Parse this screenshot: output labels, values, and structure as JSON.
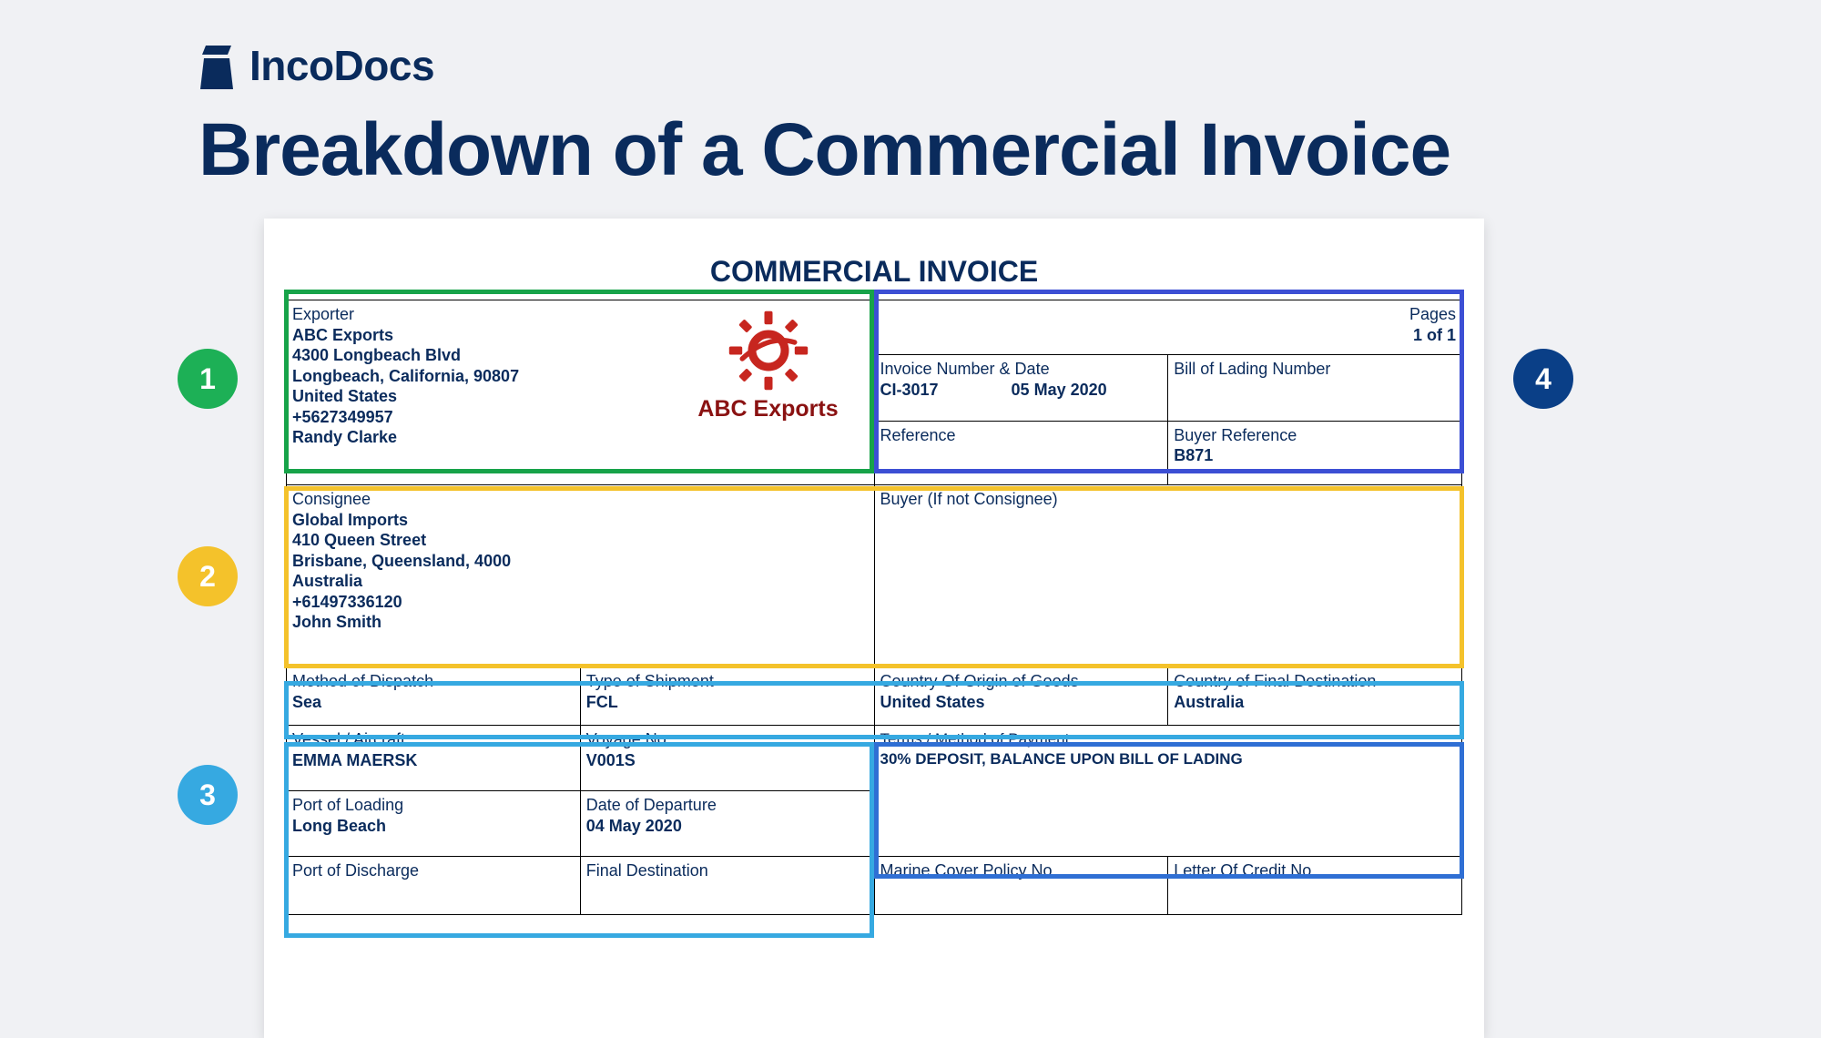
{
  "brand_name": "IncoDocs",
  "page_title": "Breakdown of a Commercial Invoice",
  "doc_title": "COMMERCIAL INVOICE",
  "badges": {
    "one": "1",
    "two": "2",
    "three": "3",
    "four": "4"
  },
  "exporter": {
    "label": "Exporter",
    "name": "ABC Exports",
    "addr1": "4300 Longbeach Blvd",
    "addr2": "Longbeach, California, 90807",
    "country": "United States",
    "phone": "+5627349957",
    "contact": "Randy Clarke",
    "logo_name": "ABC Exports"
  },
  "pages": {
    "label": "Pages",
    "value": "1 of 1"
  },
  "invoice_no": {
    "label": "Invoice Number & Date",
    "no": "CI-3017",
    "date": "05 May 2020"
  },
  "bol": {
    "label": "Bill of Lading Number",
    "value": ""
  },
  "reference": {
    "label": "Reference",
    "value": ""
  },
  "buyer_ref": {
    "label": "Buyer Reference",
    "value": "B871"
  },
  "consignee": {
    "label": "Consignee",
    "name": "Global Imports",
    "addr1": "410 Queen Street",
    "addr2": "Brisbane, Queensland, 4000",
    "country": "Australia",
    "phone": "+61497336120",
    "contact": "John Smith"
  },
  "buyer_alt": {
    "label": "Buyer (If not Consignee)",
    "value": ""
  },
  "dispatch": {
    "label": "Method of Dispatch",
    "value": "Sea"
  },
  "shipment": {
    "label": "Type of Shipment",
    "value": "FCL"
  },
  "origin": {
    "label": "Country Of Origin of Goods",
    "value": "United States"
  },
  "final_dest_c": {
    "label": "Country of Final Destination",
    "value": "Australia"
  },
  "vessel": {
    "label": "Vessel / Aircraft",
    "value": "EMMA MAERSK"
  },
  "voyage": {
    "label": "Voyage No",
    "value": "V001S"
  },
  "terms": {
    "label": "Terms / Method of Payment",
    "value": "30% DEPOSIT, BALANCE UPON BILL OF LADING"
  },
  "pol": {
    "label": "Port of Loading",
    "value": "Long Beach"
  },
  "dep_date": {
    "label": "Date of Departure",
    "value": "04 May 2020"
  },
  "pod": {
    "label": "Port of Discharge",
    "value": ""
  },
  "final_dest": {
    "label": "Final Destination",
    "value": ""
  },
  "marine": {
    "label": "Marine Cover Policy No",
    "value": ""
  },
  "loc": {
    "label": "Letter Of Credit No",
    "value": ""
  }
}
